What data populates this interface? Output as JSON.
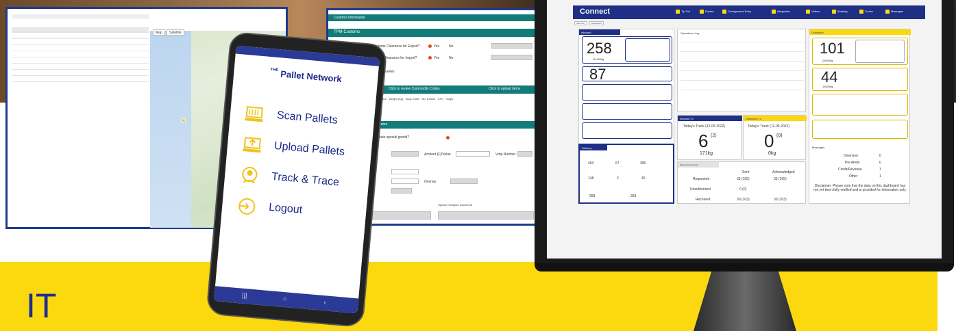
{
  "banner": {
    "section_label": "IT",
    "colors": {
      "yellow": "#fcd80f",
      "navy": "#1f2f86",
      "teal": "#127c7a"
    }
  },
  "map_screen": {
    "tabs": [
      "Map",
      "Satellite"
    ]
  },
  "form_screen": {
    "title_bar": "Customs Information",
    "section_customs": "TPM Customs",
    "q1": "Are you using TPM Customs Clearance for Export?",
    "q2": "TPM Customs Clearance for Import?",
    "yes": "Yes",
    "no": "No",
    "customs_queries": "Customs Queries",
    "commodity_btn": "Click to review Commodity Codes",
    "upload_btn": "Click to upload items",
    "table_headers": [
      "Amount Value",
      "Weight (Kg)",
      "Supp. Units",
      "No. Entries",
      "CPC",
      "Origin"
    ],
    "section_extra": "tional Information",
    "consignment_q": "ignment contain special goods?",
    "amount_label": "Amount (£)/Value",
    "vmp_label": "Vmp Number",
    "overlay_label": "Overlay",
    "upload_docs": "Upload Transport Document"
  },
  "phone": {
    "logo": "Pallet Network",
    "logo_prefix": "THE",
    "menu": [
      {
        "label": "Scan Pallets",
        "icon": "scan-pallets-icon"
      },
      {
        "label": "Upload Pallets",
        "icon": "upload-pallets-icon"
      },
      {
        "label": "Track & Trace",
        "icon": "track-trace-icon"
      },
      {
        "label": "Logout",
        "icon": "logout-icon"
      }
    ],
    "nav": [
      "|||",
      "○",
      "‹"
    ]
  },
  "dashboard": {
    "app_name": "Connect",
    "nav": [
      "Tip Out",
      "Routes",
      "Consignment Entry",
      "Integration",
      "Videos",
      "Booking",
      "Trucks",
      "Messages"
    ],
    "tabs": [
      "Summary",
      "Dashboard"
    ],
    "inbound": {
      "title": "Inbound",
      "top_number": "258",
      "top_weight": "81400kg",
      "second_number": "87"
    },
    "delivery": {
      "title": "Delivery",
      "values": [
        "463",
        "67",
        "396",
        "148",
        "2",
        "40",
        "268",
        "263"
      ]
    },
    "operations_log": {
      "title": "Operations Log"
    },
    "inbound_to": {
      "title": "Inbound To",
      "subtitle": "Today's Trunk (12-05-2022)",
      "value": "6",
      "sup": "(2)",
      "weight": "171kg"
    },
    "outbound_to": {
      "title": "Outbound To",
      "subtitle": "Today's Trunk (12-05-2022)",
      "value": "0",
      "sup": "(0)",
      "weight": "0kg"
    },
    "data_summary": {
      "title": "Data Data Summary",
      "col_sent": "Sent",
      "col_ack": "Acknowledged",
      "rows": [
        {
          "label": "Requested",
          "sent": "33 (105)",
          "ack": "33 (105)"
        },
        {
          "label": "Unauthorised",
          "sent": "0 (0)",
          "ack": ""
        },
        {
          "label": "Received",
          "sent": "30 (103)",
          "ack": "30 (103)"
        }
      ]
    },
    "outbound": {
      "title": "Outbound",
      "top_number": "101",
      "top_weight": "25600kg",
      "second_number": "44",
      "second_weight": "15609kg"
    },
    "messages": {
      "title": "Messages",
      "rows": [
        {
          "label": "Diversion",
          "value": "0"
        },
        {
          "label": "Pre Alerts",
          "value": "0"
        },
        {
          "label": "Credit/Revenue",
          "value": "1"
        },
        {
          "label": "Other",
          "value": "1"
        }
      ],
      "disclaimer": "Disclaimer: Please note that the data on this dashboard has not yet been fully verified and is provided for information only."
    }
  }
}
